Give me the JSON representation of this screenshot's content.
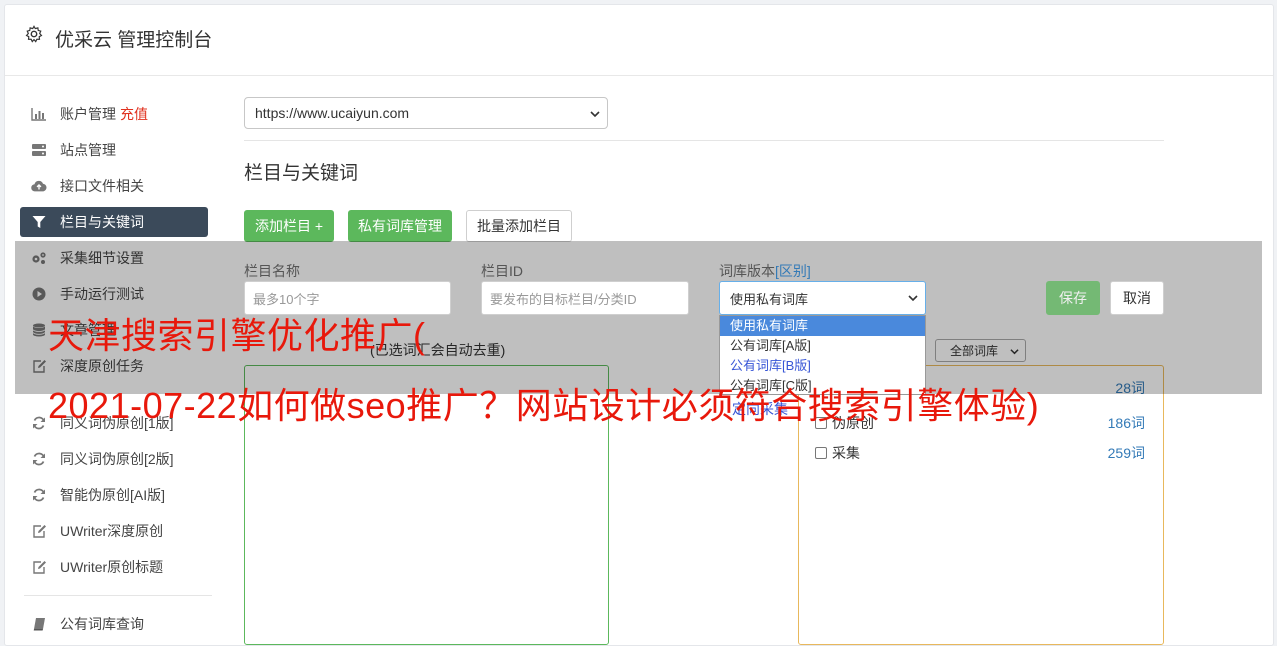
{
  "app": {
    "title": "优采云 管理控制台"
  },
  "sidebar": {
    "items": [
      {
        "label": "账户管理",
        "badge": "充值",
        "icon": "bar-chart-icon"
      },
      {
        "label": "站点管理",
        "icon": "server-icon"
      },
      {
        "label": "接口文件相关",
        "icon": "cloud-upload-icon"
      },
      {
        "label": "栏目与关键词",
        "icon": "filter-icon",
        "active": true
      },
      {
        "label": "采集细节设置",
        "icon": "gears-icon"
      },
      {
        "label": "手动运行测试",
        "icon": "play-circle-icon"
      },
      {
        "label": "文章管理",
        "icon": "database-icon"
      },
      {
        "label": "深度原创任务",
        "icon": "edit-icon"
      },
      {
        "label": "同义词伪原创[1版]",
        "icon": "refresh-icon"
      },
      {
        "label": "同义词伪原创[2版]",
        "icon": "refresh-icon"
      },
      {
        "label": "智能伪原创[AI版]",
        "icon": "refresh-icon"
      },
      {
        "label": "UWriter深度原创",
        "icon": "edit-icon"
      },
      {
        "label": "UWriter原创标题",
        "icon": "edit-icon"
      },
      {
        "label": "公有词库查询",
        "icon": "book-icon"
      }
    ]
  },
  "main": {
    "site_select": {
      "value": "https://www.ucaiyun.com"
    },
    "section_title": "栏目与关键词",
    "buttons": {
      "add_column": "添加栏目 +",
      "private_dict": "私有词库管理",
      "batch_add": "批量添加栏目"
    },
    "form": {
      "name_label": "栏目名称",
      "name_placeholder": "最多10个字",
      "id_label": "栏目ID",
      "id_placeholder": "要发布的目标栏目/分类ID",
      "dict_label": "词库版本",
      "dict_label_link": "[区别]",
      "dict_value": "使用私有词库",
      "save": "保存",
      "cancel": "取消"
    },
    "dropdown_options": [
      "使用私有词库",
      "公有词库[A版]",
      "公有词库[B版]",
      "公有词库[C版]"
    ],
    "keywords_hint": "(已选词汇会自动去重)",
    "dict_filter": "全部词库",
    "dict_list": [
      {
        "label": "",
        "count": "28词"
      },
      {
        "label": "伪原创",
        "count": "186词"
      },
      {
        "label": "采集",
        "count": "259词"
      }
    ],
    "ghost_link": "定向采集"
  },
  "watermark": {
    "line1": "天津搜索引擎优化推广(",
    "line2": "2021-07-22如何做seo推广？网站设计必须符合搜索引擎体验)"
  },
  "colors": {
    "green": "#5cb85c",
    "active_nav": "#3b4a5a",
    "link": "#337ab7",
    "watermark": "#e8180b"
  }
}
